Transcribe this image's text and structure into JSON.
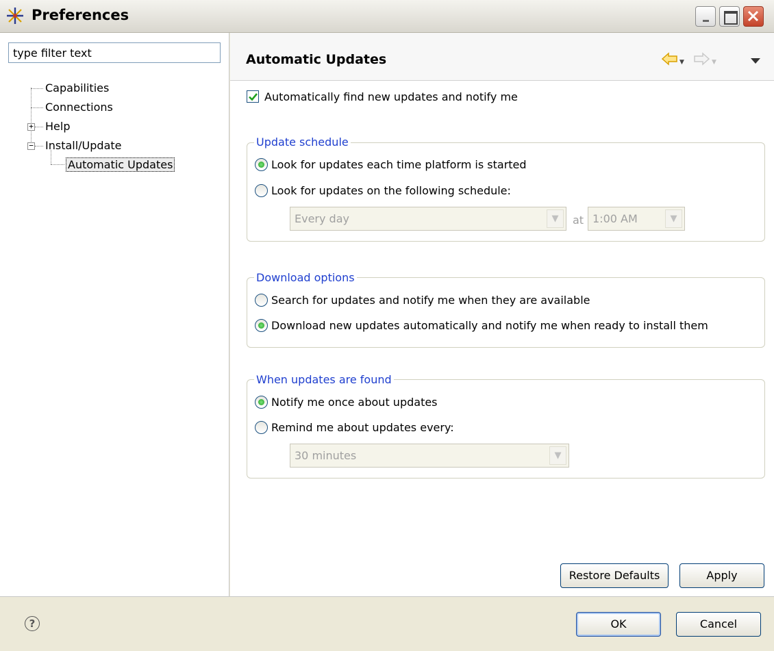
{
  "window": {
    "title": "Preferences"
  },
  "left": {
    "filter_value": "type filter text",
    "tree": [
      {
        "label": "Capabilities",
        "expandable": false
      },
      {
        "label": "Connections",
        "expandable": false
      },
      {
        "label": "Help",
        "expandable": true,
        "expanded": false
      },
      {
        "label": "Install/Update",
        "expandable": true,
        "expanded": true
      },
      {
        "label": "Automatic Updates",
        "selected": true
      }
    ]
  },
  "page": {
    "title": "Automatic Updates",
    "auto_find": {
      "label": "Automatically find new updates and notify me",
      "checked": true
    },
    "schedule_group": {
      "legend": "Update schedule",
      "opt1": "Look for updates each time platform is started",
      "opt2": "Look for updates on the following schedule:",
      "selected": "opt1",
      "frequency_value": "Every day",
      "at_label": "at",
      "time_value": "1:00 AM"
    },
    "download_group": {
      "legend": "Download options",
      "opt1": "Search for updates and notify me when they are available",
      "opt2": "Download new updates automatically and notify me when ready to install them",
      "selected": "opt2"
    },
    "found_group": {
      "legend": "When updates are found",
      "opt1": "Notify me once about updates",
      "opt2": "Remind me about updates every:",
      "selected": "opt1",
      "remind_value": "30 minutes"
    },
    "restore_defaults": "Restore Defaults",
    "apply": "Apply"
  },
  "footer": {
    "ok": "OK",
    "cancel": "Cancel"
  },
  "icons": {
    "app": "preferences-star-icon",
    "back": "back-arrow-icon",
    "forward": "forward-arrow-icon",
    "menu": "view-menu-icon",
    "help": "help-icon"
  },
  "colors": {
    "group_legend": "#1f3fcf",
    "back_arrow": "#f2c100",
    "close_button": "#c4432a",
    "radio_selected": "#21a121"
  }
}
